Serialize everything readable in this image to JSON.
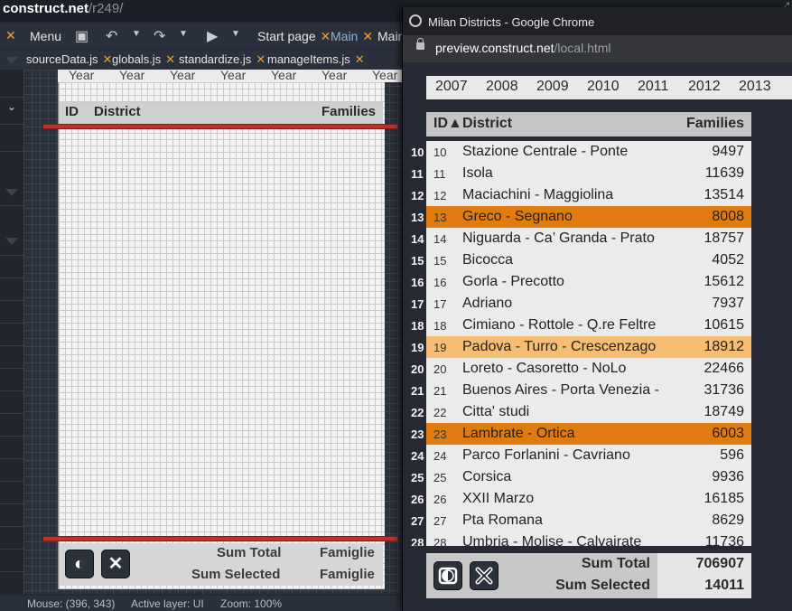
{
  "editor": {
    "url_host": "construct.net",
    "url_path": "/r249/",
    "menu": {
      "close_x": "✕",
      "menu_label": "Menu",
      "start_page_tab": "Start page",
      "main_tab_1": "Main",
      "main_tab_2": "Main"
    },
    "file_tabs": [
      {
        "label": "sourceData.js"
      },
      {
        "label": "globals.js"
      },
      {
        "label": "standardize.js"
      },
      {
        "label": "manageItems.js"
      }
    ],
    "year_strip": [
      "Year",
      "Year",
      "Year",
      "Year",
      "Year",
      "Year",
      "Year"
    ],
    "header": {
      "id": "ID",
      "district": "District",
      "families": "Families"
    },
    "footer": {
      "sum_total": "Sum Total",
      "sum_selected": "Sum Selected",
      "famiglie_1": "Famiglie",
      "famiglie_2": "Famiglie"
    },
    "status": {
      "mouse": "Mouse: (396, 343)",
      "active_layer": "Active layer: UI",
      "zoom": "Zoom: 100%"
    },
    "right_labels": [
      "20",
      "20",
      "20",
      "20",
      "20",
      "20",
      "20",
      "20",
      "20",
      "20",
      "20",
      "20",
      "20"
    ]
  },
  "chrome": {
    "window_title": "Milan Districts - Google Chrome",
    "address_host": "preview.construct.net",
    "address_path": "/local.html"
  },
  "app": {
    "years": [
      "2007",
      "2008",
      "2009",
      "2010",
      "2011",
      "2012",
      "2013"
    ],
    "header": {
      "id": "ID▲",
      "district": "District",
      "families": "Families"
    },
    "rows": [
      {
        "id": "10",
        "name": "Stazione Centrale - Ponte",
        "families": "9497",
        "state": "none"
      },
      {
        "id": "11",
        "name": "Isola",
        "families": "11639",
        "state": "none"
      },
      {
        "id": "12",
        "name": "Maciachini - Maggiolina",
        "families": "13514",
        "state": "none"
      },
      {
        "id": "13",
        "name": "Greco - Segnano",
        "families": "8008",
        "state": "selected"
      },
      {
        "id": "14",
        "name": "Niguarda - Ca’ Granda - Prato",
        "families": "18757",
        "state": "none"
      },
      {
        "id": "15",
        "name": "Bicocca",
        "families": "4052",
        "state": "none"
      },
      {
        "id": "16",
        "name": "Gorla - Precotto",
        "families": "15612",
        "state": "none"
      },
      {
        "id": "17",
        "name": "Adriano",
        "families": "7937",
        "state": "none"
      },
      {
        "id": "18",
        "name": "Cimiano - Rottole - Q.re Feltre",
        "families": "10615",
        "state": "none"
      },
      {
        "id": "19",
        "name": "Padova - Turro - Crescenzago",
        "families": "18912",
        "state": "hover"
      },
      {
        "id": "20",
        "name": "Loreto - Casoretto - NoLo",
        "families": "22466",
        "state": "none"
      },
      {
        "id": "21",
        "name": "Buenos Aires - Porta Venezia -",
        "families": "31736",
        "state": "none"
      },
      {
        "id": "22",
        "name": "Citta' studi",
        "families": "18749",
        "state": "none"
      },
      {
        "id": "23",
        "name": "Lambrate - Ortica",
        "families": "6003",
        "state": "selected"
      },
      {
        "id": "24",
        "name": "Parco Forlanini - Cavriano",
        "families": "596",
        "state": "none"
      },
      {
        "id": "25",
        "name": "Corsica",
        "families": "9936",
        "state": "none"
      },
      {
        "id": "26",
        "name": "XXII Marzo",
        "families": "16185",
        "state": "none"
      },
      {
        "id": "27",
        "name": "Pta Romana",
        "families": "8629",
        "state": "none"
      },
      {
        "id": "28",
        "name": "Umbria - Molise - Calvairate",
        "families": "11736",
        "state": "none"
      }
    ],
    "footer": {
      "sum_total_label": "Sum Total",
      "sum_total_value": "706907",
      "sum_selected_label": "Sum Selected",
      "sum_selected_value": "14011"
    },
    "colors": {
      "selected": "#e07b10",
      "hover": "#f5be73"
    }
  }
}
